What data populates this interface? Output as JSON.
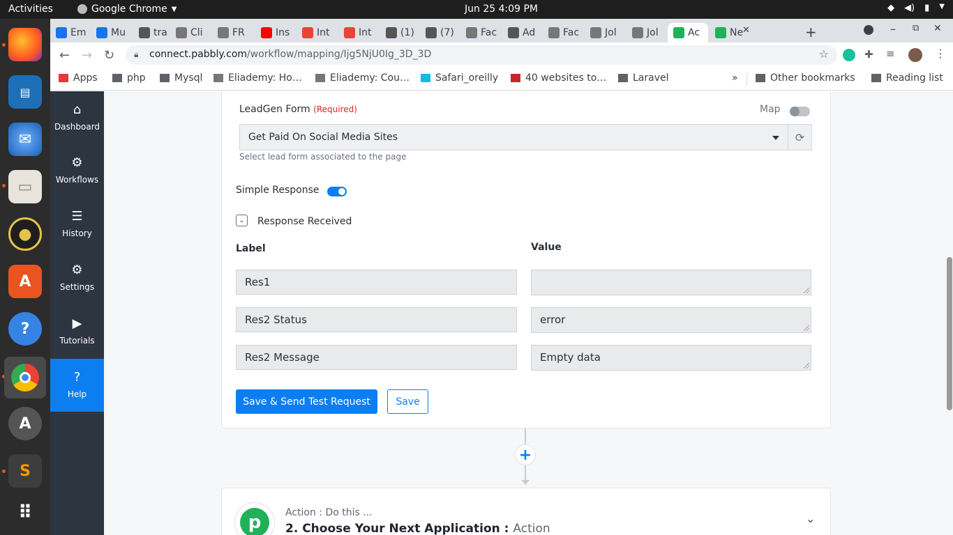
{
  "system": {
    "activities": "Activities",
    "app_name": "Google Chrome",
    "clock": "Jun 25   4:09 PM"
  },
  "tabs": [
    {
      "label": "Em",
      "color": "#1a73e8"
    },
    {
      "label": "Mu",
      "color": "#1a73e8"
    },
    {
      "label": "tra",
      "color": "#555555"
    },
    {
      "label": "Cli",
      "color": "#777777"
    },
    {
      "label": "FR",
      "color": "#777777"
    },
    {
      "label": "Ins",
      "color": "#ff0000"
    },
    {
      "label": "Int",
      "color": "#ea4335"
    },
    {
      "label": "Int",
      "color": "#ea4335"
    },
    {
      "label": "(1)",
      "color": "#555555"
    },
    {
      "label": "(7)",
      "color": "#555555"
    },
    {
      "label": "Fac",
      "color": "#777777"
    },
    {
      "label": "Ad",
      "color": "#555555"
    },
    {
      "label": "Fac",
      "color": "#777777"
    },
    {
      "label": "Jol",
      "color": "#777777"
    },
    {
      "label": "Jol",
      "color": "#777777"
    },
    {
      "label": "Ac",
      "color": "#20b15a"
    },
    {
      "label": "Ne",
      "color": "#20b15a"
    }
  ],
  "url": {
    "host": "connect.pabbly.com",
    "path": "/workflow/mapping/Ijg5NjU0Ig_3D_3D"
  },
  "bookmarks": [
    {
      "label": "Apps"
    },
    {
      "label": "php"
    },
    {
      "label": "Mysql"
    },
    {
      "label": "Eliademy: Ho…"
    },
    {
      "label": "Eliademy: Cou…"
    },
    {
      "label": "Safari_oreilly"
    },
    {
      "label": "40 websites to…"
    },
    {
      "label": "Laravel"
    },
    {
      "label": "»"
    },
    {
      "label": "Other bookmarks"
    },
    {
      "label": "Reading list"
    }
  ],
  "sidebar": {
    "items": [
      {
        "label": "Dashboard"
      },
      {
        "label": "Workflows"
      },
      {
        "label": "History"
      },
      {
        "label": "Settings"
      },
      {
        "label": "Tutorials"
      },
      {
        "label": "Help"
      }
    ]
  },
  "form": {
    "leadgen_label": "LeadGen Form",
    "required_label": "(Required)",
    "map_label": "Map",
    "selected_form": "Get Paid On Social Media Sites",
    "hint": "Select lead form associated to the page",
    "simple_response_label": "Simple Response",
    "response_received_label": "Response Received",
    "label_header": "Label",
    "value_header": "Value",
    "rows": [
      {
        "label": "Res1",
        "value": ""
      },
      {
        "label": "Res2 Status",
        "value": "error"
      },
      {
        "label": "Res2 Message",
        "value": "Empty data"
      }
    ],
    "save_send_label": "Save & Send Test Request",
    "save_label": "Save"
  },
  "next_action": {
    "subtitle": "Action : Do this ...",
    "title": "2. Choose Your Next Application :",
    "tag": "Action"
  },
  "colors": {
    "accent": "#0d7ef2",
    "sidebar_bg": "#2d3540",
    "required": "#d9262c",
    "pabbly_green": "#20b15a"
  }
}
